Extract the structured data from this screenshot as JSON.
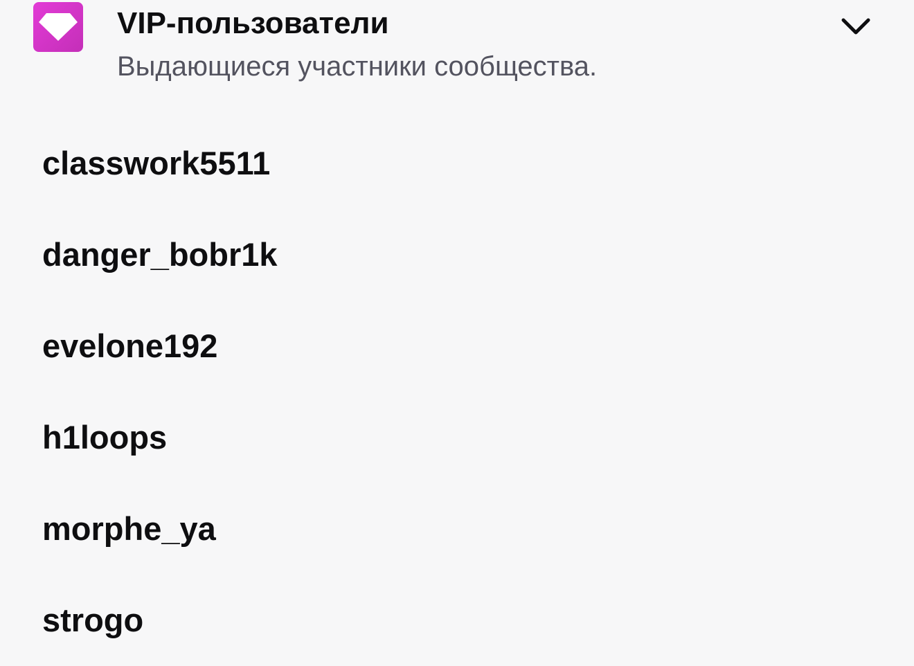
{
  "section": {
    "icon": "gem-icon",
    "accent_color": "#d236c8",
    "title": "VIP-пользователи",
    "subtitle": "Выдающиеся участники сообщества.",
    "toggle_icon": "chevron-down-icon"
  },
  "users": [
    "classwork5511",
    "danger_bobr1k",
    "evelone192",
    "h1loops",
    "morphe_ya",
    "strogo"
  ]
}
